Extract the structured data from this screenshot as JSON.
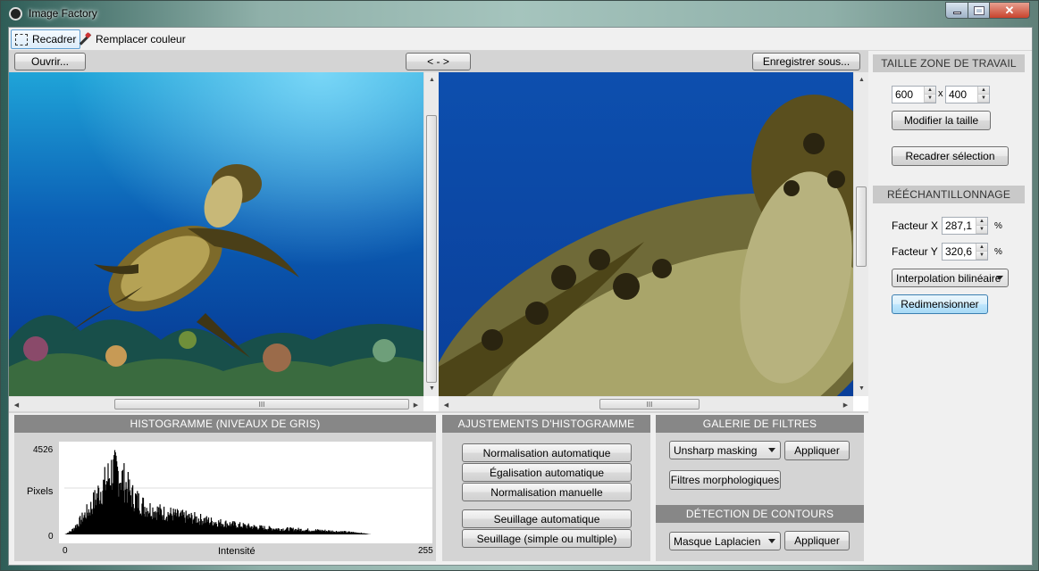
{
  "window": {
    "title": "Image Factory",
    "close_symbol": "✕"
  },
  "toolbar": {
    "crop_label": "Recadrer",
    "replace_color_label": "Remplacer couleur"
  },
  "viewer": {
    "open_label": "Ouvrir...",
    "swap_label": "< - >",
    "save_as_label": "Enregistrer sous...",
    "scroll_grip": "III"
  },
  "workspace": {
    "header": "TAILLE ZONE DE TRAVAIL",
    "width": "600",
    "separator": "x",
    "height": "400",
    "resize_label": "Modifier la taille",
    "crop_selection_label": "Recadrer sélection"
  },
  "resampling": {
    "header": "RÉÉCHANTILLONNAGE",
    "factor_x_label": "Facteur X",
    "factor_x": "287,1",
    "factor_x_unit": "%",
    "factor_y_label": "Facteur Y",
    "factor_y": "320,6",
    "factor_y_unit": "%",
    "interpolation": "Interpolation bilinéaire",
    "resize_button": "Redimensionner"
  },
  "histogram": {
    "header": "HISTOGRAMME  (NIVEAUX DE GRIS)",
    "y_max": "4526",
    "y_label": "Pixels",
    "y_min": "0",
    "x_label": "Intensité",
    "x_min": "0",
    "x_max": "255"
  },
  "adjustments": {
    "header": "AJUSTEMENTS D'HISTOGRAMME",
    "auto_normalization": "Normalisation automatique",
    "auto_equalization": "Égalisation automatique",
    "manual_normalization": "Normalisation manuelle",
    "auto_threshold": "Seuillage automatique",
    "threshold_multi": "Seuillage (simple ou multiple)"
  },
  "filters": {
    "header": "GALERIE DE FILTRES",
    "filter_selected": "Unsharp masking",
    "apply_label": "Appliquer",
    "morph_label": "Filtres morphologiques"
  },
  "edges": {
    "header": "DÉTECTION DE CONTOURS",
    "selected": "Masque Laplacien",
    "apply_label": "Appliquer"
  },
  "chart_data": {
    "type": "bar",
    "xlabel": "Intensité",
    "ylabel": "Pixels",
    "xlim": [
      0,
      255
    ],
    "ylim": [
      0,
      4526
    ],
    "x_range": [
      0,
      255
    ],
    "values_description_free": true,
    "envelope_x": [
      0,
      5,
      10,
      15,
      20,
      25,
      30,
      35,
      40,
      45,
      50,
      55,
      60,
      65,
      70,
      75,
      80,
      85,
      90,
      95,
      100,
      110,
      120,
      130,
      140,
      150,
      160,
      170,
      180,
      190,
      200,
      210,
      220,
      230
    ],
    "envelope_y": [
      0,
      200,
      600,
      1050,
      1500,
      2200,
      2700,
      3400,
      3300,
      2800,
      2100,
      1800,
      1500,
      1350,
      1250,
      1150,
      1100,
      1000,
      950,
      900,
      850,
      700,
      600,
      500,
      420,
      350,
      300,
      280,
      250,
      220,
      180,
      140,
      100,
      0
    ]
  }
}
